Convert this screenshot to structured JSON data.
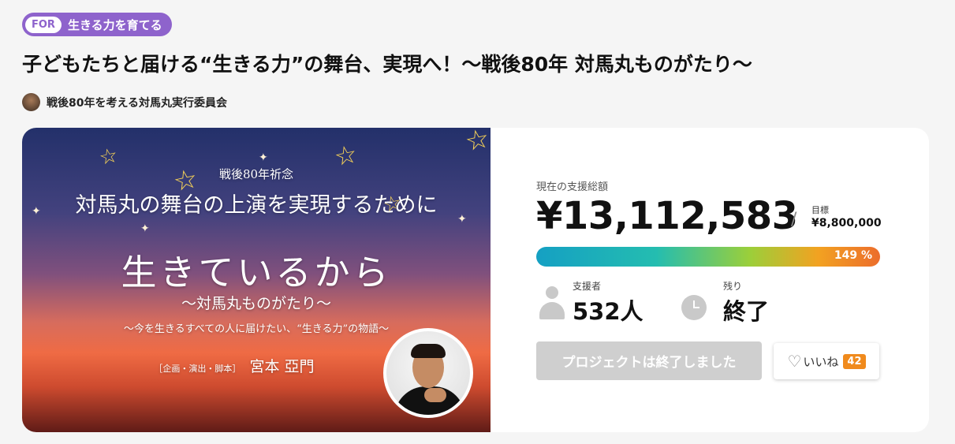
{
  "tag": {
    "for_label": "FOR",
    "label": "生きる力を育てる"
  },
  "title": "子どもたちと届ける“生きる力”の舞台、実現へ！〜戦後80年 対馬丸ものがたり〜",
  "owner": {
    "name": "戦後80年を考える対馬丸実行委員会"
  },
  "hero": {
    "anniversary": "戦後80年祈念",
    "headline": "対馬丸の舞台の上演を実現するために",
    "main_title": "生きているから",
    "sub_title": "〜対馬丸ものがたり〜",
    "tagline": "〜今を生きるすべての人に届けたい、“生きる力”の物語〜",
    "credit_role": "［企画・演出・脚本］",
    "credit_name": "宮本 亞門"
  },
  "stats": {
    "total_label": "現在の支援総額",
    "total": "¥13,112,583",
    "slash": "/",
    "goal_label": "目標",
    "goal": "¥8,800,000",
    "percent": "149 %",
    "progress_fraction": 1.0,
    "backers_label": "支援者",
    "backers": "532人",
    "remaining_label": "残り",
    "remaining": "終了"
  },
  "actions": {
    "ended_label": "プロジェクトは終了しました",
    "like_label": "いいね",
    "like_count": "42"
  },
  "colors": {
    "tag": "#8e63cc",
    "like_badge": "#f08a1c",
    "button_disabled": "#cfcfcf"
  },
  "icons": [
    "person-icon",
    "clock-icon",
    "heart-icon",
    "star-icon"
  ]
}
